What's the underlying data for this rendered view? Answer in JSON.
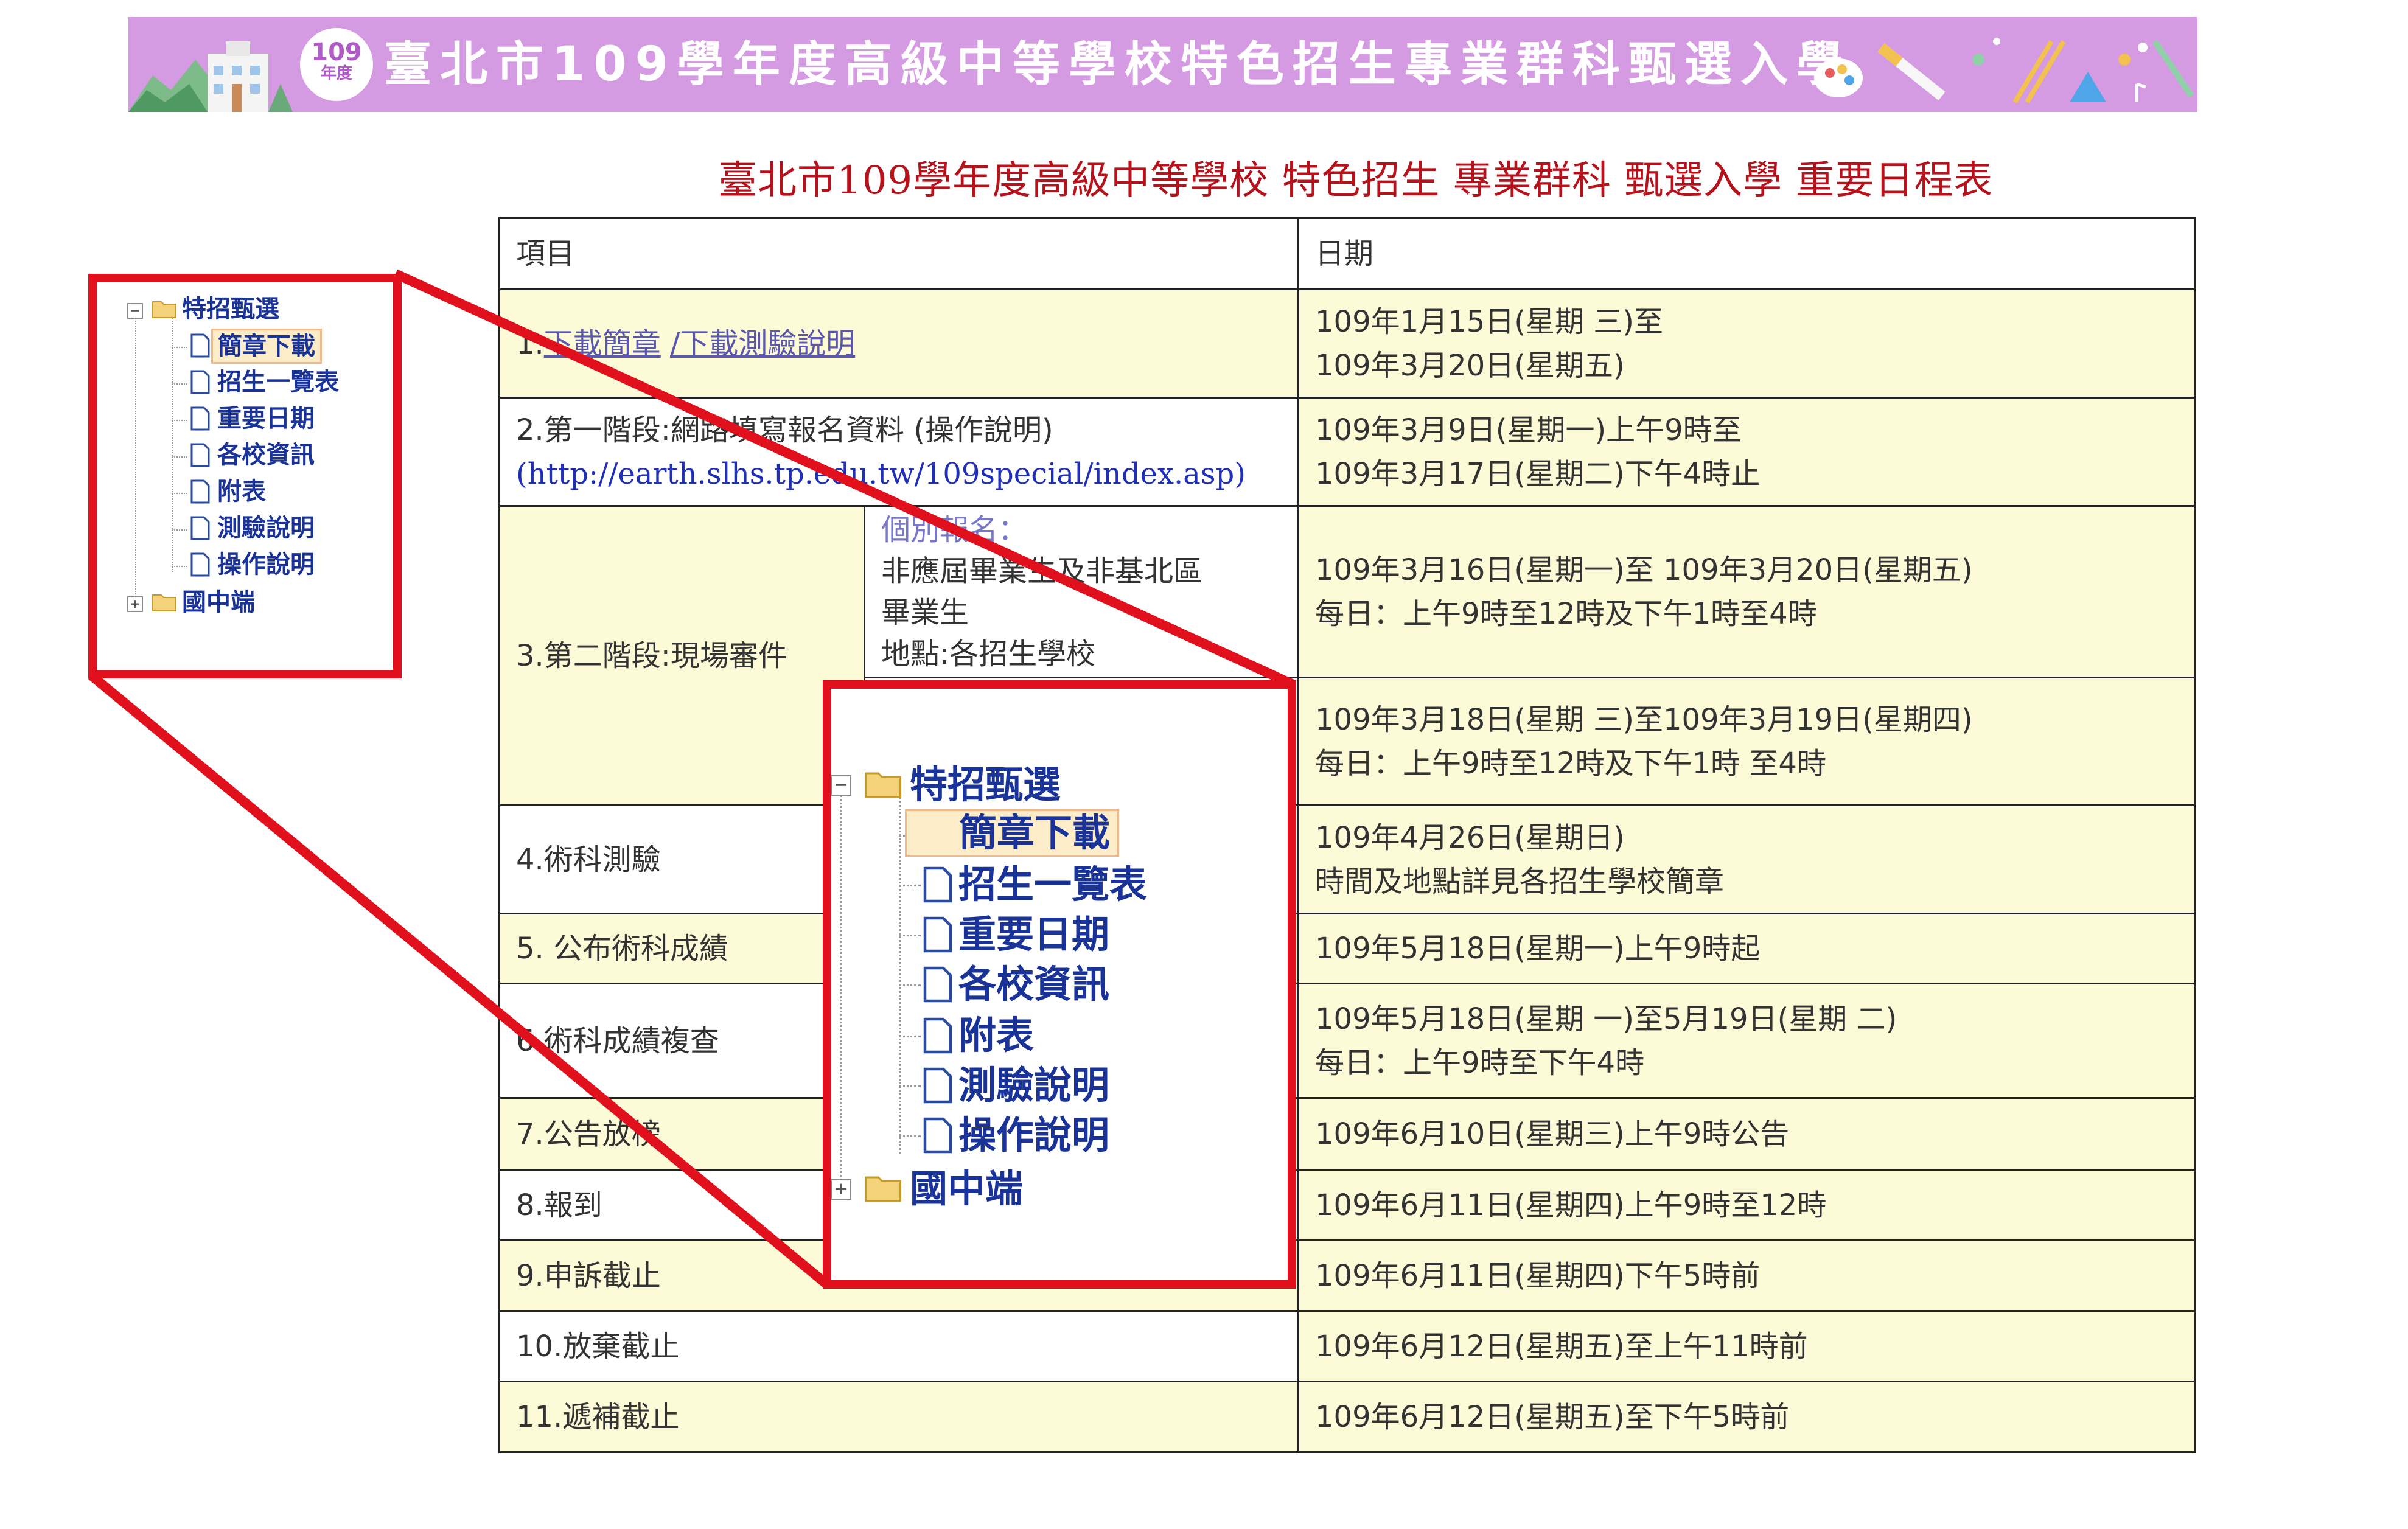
{
  "banner": {
    "badge_year": "109",
    "badge_label": "年度",
    "title": "臺北市109學年度高級中等學校特色招生專業群科甄選入學",
    "colors": {
      "background": "#d59be2",
      "text": "#ffffff"
    }
  },
  "heading": "臺北市109學年度高級中等學校 特色招生 專業群科 甄選入學 重要日程表",
  "schedule": {
    "headers": {
      "item": "項目",
      "date": "日期"
    },
    "row1": {
      "prefix": "1.",
      "link_brochure": "下載簡章",
      "link_test": "/下載測驗說明",
      "date_line1": "109年1月15日(星期 三)至",
      "date_line2": "109年3月20日(星期五)"
    },
    "row2": {
      "item_line1": "2.第一階段:網路填寫報名資料 (操作說明)",
      "item_url": "(http://earth.slhs.tp.edu.tw/109special/index.asp)",
      "date_line1": "109年3月9日(星期一)上午9時至",
      "date_line2": "109年3月17日(星期二)下午4時止"
    },
    "row3": {
      "item": "3.第二階段:現場審件",
      "sub_title": "個別報名：",
      "sub_line1": "非應屆畢業生及非基北區",
      "sub_line2": "畢業生",
      "sub_line3": "地點:各招生學校",
      "date_a_line1": "109年3月16日(星期一)至 109年3月20日(星期五)",
      "date_a_line2": "每日：上午9時至12時及下午1時至4時",
      "date_b_line1": "109年3月18日(星期 三)至109年3月19日(星期四)",
      "date_b_line2": "每日：上午9時至12時及下午1時 至4時"
    },
    "rows_simple": [
      {
        "item": "4.術科測驗",
        "date_line1": "109年4月26日(星期日)",
        "date_line2": "時間及地點詳見各招生學校簡章"
      },
      {
        "item": "5. 公布術科成績",
        "date_line1": "109年5月18日(星期一)上午9時起",
        "date_line2": ""
      },
      {
        "item": "6.術科成績複查",
        "date_line1": "109年5月18日(星期 一)至5月19日(星期 二)",
        "date_line2": "每日：上午9時至下午4時"
      },
      {
        "item": "7.公告放榜",
        "date_line1": "109年6月10日(星期三)上午9時公告",
        "date_line2": ""
      },
      {
        "item": "8.報到",
        "date_line1": "109年6月11日(星期四)上午9時至12時",
        "date_line2": ""
      },
      {
        "item": "9.申訴截止",
        "date_line1": "109年6月11日(星期四)下午5時前",
        "date_line2": ""
      },
      {
        "item": "10.放棄截止",
        "date_line1": "109年6月12日(星期五)至上午11時前",
        "date_line2": ""
      },
      {
        "item": "11.遞補截止",
        "date_line1": "109年6月12日(星期五)至下午5時前",
        "date_line2": ""
      }
    ],
    "colors": {
      "date_cell": "#fdfad7",
      "border": "#222222"
    }
  },
  "tree": {
    "root_label": "特招甄選",
    "root_toggle": "−",
    "items": [
      "簡章下載",
      "招生一覽表",
      "重要日期",
      "各校資訊",
      "附表",
      "測驗說明",
      "操作說明"
    ],
    "selected_item": "簡章下載",
    "second_folder": "國中端",
    "second_toggle": "+",
    "colors": {
      "text": "#1a3399",
      "selected_bg": "#fdecc8"
    }
  },
  "annotation": {
    "color": "#e0101c"
  }
}
